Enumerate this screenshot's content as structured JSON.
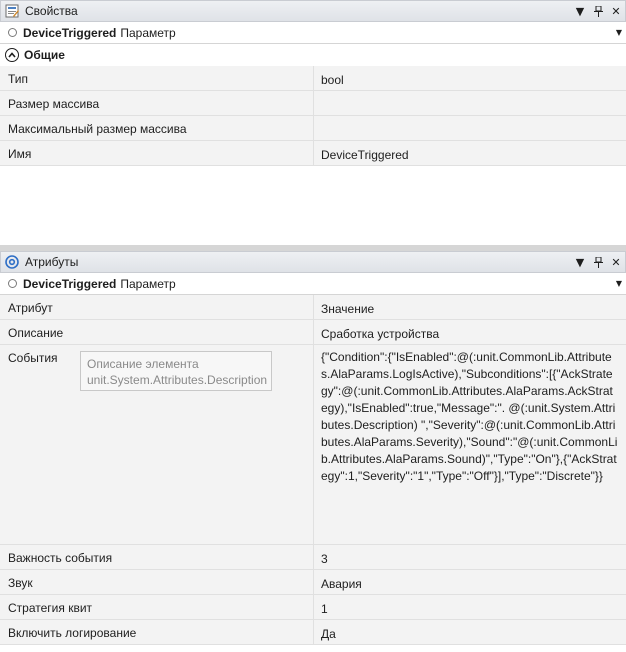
{
  "properties": {
    "title": "Свойства",
    "object_name": "DeviceTriggered",
    "object_type": "Параметр",
    "group": "Общие",
    "rows": [
      {
        "key": "Тип",
        "value": "bool"
      },
      {
        "key": "Размер массива",
        "value": ""
      },
      {
        "key": "Максимальный размер массива",
        "value": ""
      },
      {
        "key": "Имя",
        "value": "DeviceTriggered"
      }
    ]
  },
  "attributes": {
    "title": "Атрибуты",
    "object_name": "DeviceTriggered",
    "object_type": "Параметр",
    "header": {
      "key": "Атрибут",
      "value": "Значение"
    },
    "rows": [
      {
        "key": "Описание",
        "value": "Сработка устройства"
      },
      {
        "key": "События",
        "value": "{\"Condition\":{\"IsEnabled\":@(:unit.CommonLib.Attributes.AlaParams.LogIsActive),\"Subconditions\":[{\"AckStrategy\":@(:unit.CommonLib.Attributes.AlaParams.AckStrategy),\"IsEnabled\":true,\"Message\":\". @(:unit.System.Attributes.Description) \",\"Severity\":@(:unit.CommonLib.Attributes.AlaParams.Severity),\"Sound\":\"@(:unit.CommonLib.Attributes.AlaParams.Sound)\",\"Type\":\"On\"},{\"AckStrategy\":1,\"Severity\":\"1\",\"Type\":\"Off\"}],\"Type\":\"Discrete\"}}"
      },
      {
        "key": "Важность события",
        "value": "3"
      },
      {
        "key": "Звук",
        "value": "Авария"
      },
      {
        "key": "Стратегия квит",
        "value": "1"
      },
      {
        "key": "Включить логирование",
        "value": "Да"
      }
    ],
    "tooltip": "Описание элемента unit.System.Attributes.Description"
  },
  "window_buttons": {
    "menu": "▼",
    "pin": "📌",
    "close": "✕"
  },
  "icons": {
    "properties": "properties-icon",
    "attributes": "at-sign-icon",
    "collapse": "chevron-up-icon"
  }
}
